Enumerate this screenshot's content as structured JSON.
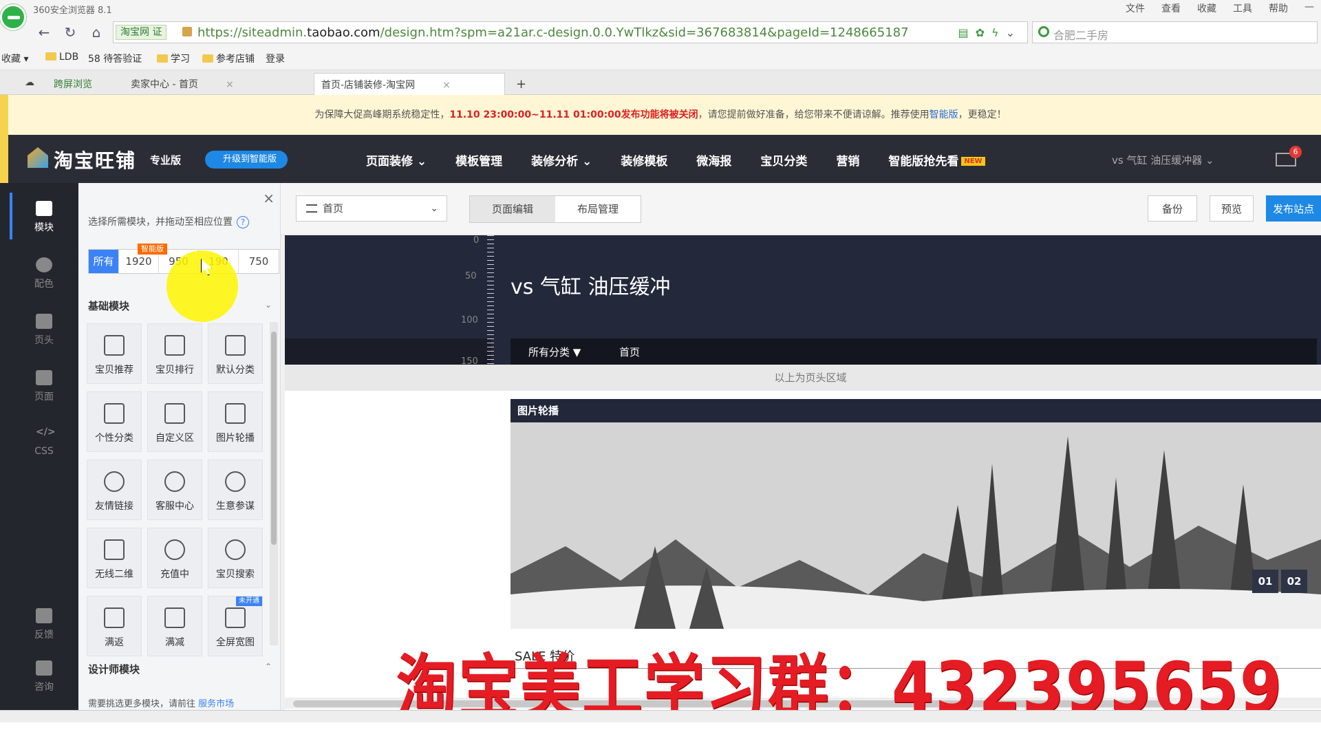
{
  "browser": {
    "title": "360安全浏览器 8.1",
    "menu": [
      "文件",
      "查看",
      "收藏",
      "工具",
      "帮助"
    ],
    "site_chip": "淘宝网 证",
    "url_prefix": "https://siteadmin.",
    "url_host": "taobao.com",
    "url_path": "/design.htm?spm=a21ar.c-design.0.0.YwTlkz&sid=367683814&pageId=1248665187",
    "search_placeholder": "合肥二手房",
    "favorites": {
      "label": "收藏",
      "items": [
        "LDB",
        "58 待答验证",
        "学习",
        "参考店铺",
        "登录"
      ]
    },
    "tabs": [
      {
        "label": "跨屏浏览"
      },
      {
        "label": "卖家中心 - 首页"
      },
      {
        "label": "首页-店铺装修-淘宝网"
      }
    ]
  },
  "notice": {
    "prefix": "为保障大促高峰期系统稳定性，",
    "time": "11.10 23:00:00~11.11 01:00:00发布功能将被关闭",
    "middle": "，请您提前做好准备，给您带来不便请谅解。推荐使用",
    "link": "智能版",
    "suffix": "，更稳定！"
  },
  "header": {
    "logo_text": "淘宝旺铺",
    "edition": "专业版",
    "upgrade_label": "升级到智能版",
    "nav": [
      {
        "label": "页面装修",
        "caret": true
      },
      {
        "label": "模板管理",
        "caret": false
      },
      {
        "label": "装修分析",
        "caret": true
      },
      {
        "label": "装修模板",
        "caret": false
      },
      {
        "label": "微海报",
        "caret": false
      },
      {
        "label": "宝贝分类",
        "caret": false
      },
      {
        "label": "营销",
        "caret": false
      },
      {
        "label": "智能版抢先看",
        "caret": false
      }
    ],
    "new_badge": "NEW",
    "shop_select": "vs 气缸 油压缓冲器",
    "mail_count": "6"
  },
  "rail": {
    "items": [
      {
        "label": "模块",
        "active": true
      },
      {
        "label": "配色",
        "active": false
      },
      {
        "label": "页头",
        "active": false
      },
      {
        "label": "页面",
        "active": false
      },
      {
        "label": "CSS",
        "active": false
      },
      {
        "label": "反馈",
        "active": false
      },
      {
        "label": "咨询",
        "active": false
      }
    ]
  },
  "panel": {
    "tip": "选择所需模块，并拖动至相应位置",
    "size_tabs": [
      "所有",
      "1920",
      "950",
      "190",
      "750"
    ],
    "smart_tag": "智能版",
    "basic_title": "基础模块",
    "modules": [
      {
        "label": "宝贝推荐",
        "icon": "bag-icon"
      },
      {
        "label": "宝贝排行",
        "icon": "rank-list-icon"
      },
      {
        "label": "默认分类",
        "icon": "category-icon"
      },
      {
        "label": "个性分类",
        "icon": "custom-category-icon"
      },
      {
        "label": "自定义区",
        "icon": "grid-icon"
      },
      {
        "label": "图片轮播",
        "icon": "image-carousel-icon"
      },
      {
        "label": "友情链接",
        "icon": "link-icon"
      },
      {
        "label": "客服中心",
        "icon": "service-icon"
      },
      {
        "label": "生意参谋",
        "icon": "compass-icon"
      },
      {
        "label": "无线二维",
        "icon": "qrcode-icon"
      },
      {
        "label": "充值中",
        "icon": "dollar-icon"
      },
      {
        "label": "宝贝搜索",
        "icon": "search-icon"
      },
      {
        "label": "满返",
        "icon": "grid-icon"
      },
      {
        "label": "满减",
        "icon": "grid-icon"
      },
      {
        "label": "全屏宽图",
        "icon": "image-icon",
        "badge": "未开通"
      }
    ],
    "designer_title": "设计师模块",
    "footer_text": "需要挑选更多模块，请前往",
    "footer_link": "服务市场"
  },
  "toolbar": {
    "page_select": "首页",
    "tab_edit": "页面编辑",
    "tab_layout": "布局管理",
    "backup": "备份",
    "preview": "预览",
    "publish": "发布站点"
  },
  "canvas": {
    "ruler_labels": [
      "0",
      "50",
      "100",
      "150"
    ],
    "shop_title": "vs 气缸 油压缓冲",
    "nav_all": "所有分类 ▼",
    "nav_home": "首页",
    "header_note": "以上为页头区域",
    "carousel_title": "图片轮播",
    "pager": [
      "01",
      "02"
    ],
    "sale_text": "SALE 特价"
  },
  "watermark": "淘宝美工学习群：432395659"
}
